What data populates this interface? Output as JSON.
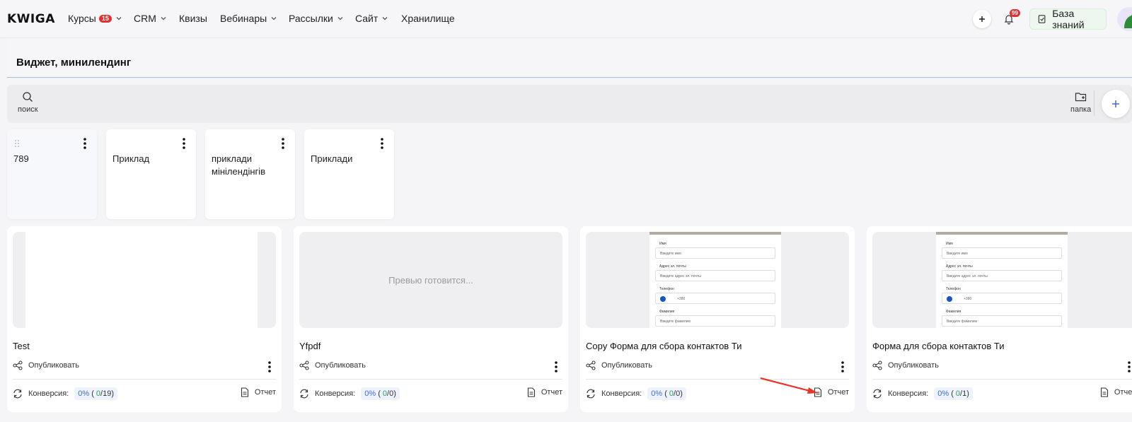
{
  "app": {
    "logo": "KWIGA"
  },
  "nav": {
    "items": [
      {
        "label": "Курсы",
        "badge": "15",
        "has_dropdown": true
      },
      {
        "label": "CRM",
        "has_dropdown": true
      },
      {
        "label": "Квизы",
        "has_dropdown": false
      },
      {
        "label": "Вебинары",
        "has_dropdown": true
      },
      {
        "label": "Рассылки",
        "has_dropdown": true
      },
      {
        "label": "Сайт",
        "has_dropdown": true
      },
      {
        "label": "Хранилище",
        "has_dropdown": false
      }
    ],
    "notifications_count": "99",
    "knowledge_base_label": "База знаний"
  },
  "page": {
    "title": "Виджет, минилендинг"
  },
  "toolbar": {
    "search_label": "поиск",
    "folder_label": "папка"
  },
  "folders": [
    {
      "name": "789"
    },
    {
      "name": "Приклад"
    },
    {
      "name": "приклади мінілендінгів"
    },
    {
      "name": "Приклади"
    }
  ],
  "cards": [
    {
      "title": "Test",
      "preview": "blank",
      "preview_text": "",
      "publish_label": "Опубликовать",
      "conversion_label": "Конверсия:",
      "conv_pct": "0%",
      "conv_open": "(",
      "conv_num": "0",
      "conv_den": "/19)",
      "report_label": "Отчет"
    },
    {
      "title": "Yfpdf",
      "preview": "pending",
      "preview_text": "Превью готовится...",
      "publish_label": "Опубликовать",
      "conversion_label": "Конверсия:",
      "conv_pct": "0%",
      "conv_open": "(",
      "conv_num": "0",
      "conv_den": "/0)",
      "report_label": "Отчет"
    },
    {
      "title": "Copy Форма для сбора контактов Ти",
      "preview": "form",
      "preview_text": "",
      "publish_label": "Опубликовать",
      "conversion_label": "Конверсия:",
      "conv_pct": "0%",
      "conv_open": "(",
      "conv_num": "0",
      "conv_den": "/0)",
      "report_label": "Отчет"
    },
    {
      "title": "Форма для сбора контактов Ти",
      "preview": "form",
      "preview_text": "",
      "publish_label": "Опубликовать",
      "conversion_label": "Конверсия:",
      "conv_pct": "0%",
      "conv_open": "(",
      "conv_num": "0",
      "conv_den": "/1)",
      "report_label": "Отчет"
    }
  ],
  "form_preview": {
    "name_label": "Имя",
    "name_placeholder": "Введите имя",
    "email_label": "Адрес эл. почты",
    "email_placeholder": "Введите адрес эл. почты",
    "phone_label": "Телефон",
    "phone_value": "+380",
    "surname_label": "Фамилия",
    "surname_placeholder": "Введите фамилию"
  },
  "colors": {
    "accent": "#3d6cd6",
    "badge_red": "#e0302f",
    "annotation_arrow": "#e8352b"
  },
  "annotation": {
    "type": "arrow",
    "points_to": "report-button card 3"
  }
}
